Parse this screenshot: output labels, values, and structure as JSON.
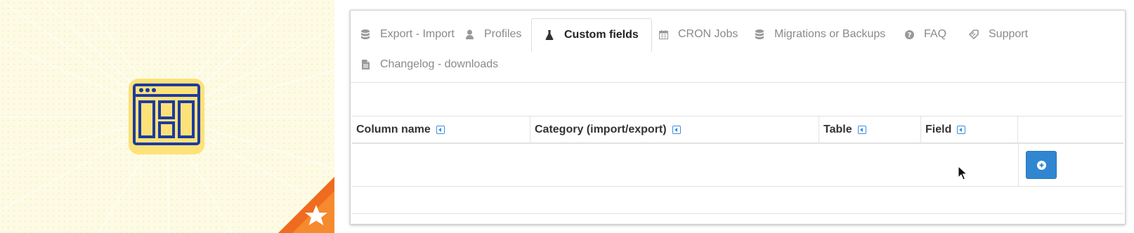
{
  "tabs": [
    {
      "label": "Export - Import",
      "icon": "database-icon"
    },
    {
      "label": "Profiles",
      "icon": "user-icon"
    },
    {
      "label": "Custom fields",
      "icon": "flask-icon",
      "active": true
    },
    {
      "label": "CRON Jobs",
      "icon": "calendar-icon"
    },
    {
      "label": "Migrations or Backups",
      "icon": "database-icon"
    },
    {
      "label": "FAQ",
      "icon": "question-circle-icon"
    },
    {
      "label": "Support",
      "icon": "ticket-icon"
    },
    {
      "label": "Changelog - downloads",
      "icon": "file-icon"
    }
  ],
  "table": {
    "columns": [
      "Column name",
      "Category (import/export)",
      "Table",
      "Field",
      ""
    ]
  },
  "colors": {
    "accent": "#3186d1",
    "promo_bg": "#fdfbe3",
    "icon_yellow": "#fde27a",
    "icon_blue": "#1e3a9e",
    "corner_orange": "#ef6b1f"
  }
}
